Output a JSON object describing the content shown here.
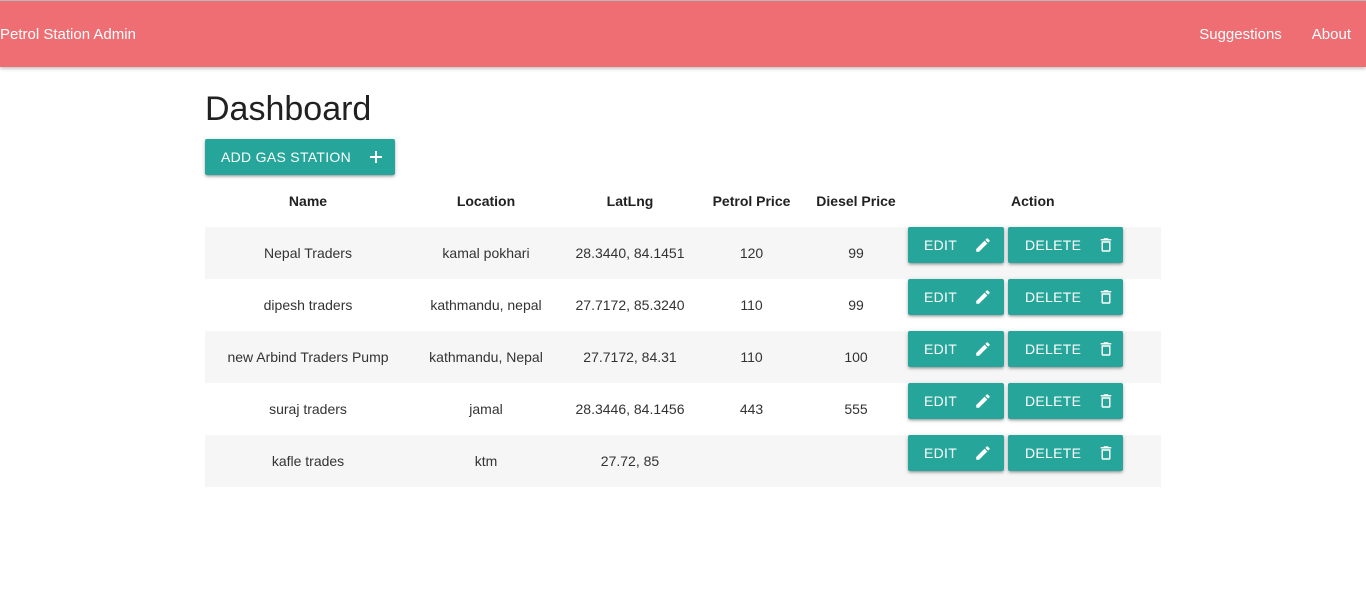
{
  "navbar": {
    "brand": "Petrol Station Admin",
    "links": [
      "Suggestions",
      "About"
    ],
    "color": "#ee6e73"
  },
  "page": {
    "title": "Dashboard",
    "add_button_label": "ADD GAS STATION"
  },
  "table": {
    "headers": [
      "Name",
      "Location",
      "LatLng",
      "Petrol Price",
      "Diesel Price",
      "Action"
    ],
    "edit_label": "EDIT",
    "delete_label": "DELETE",
    "rows": [
      {
        "name": "Nepal Traders",
        "location": "kamal pokhari",
        "latlng": "28.3440, 84.1451",
        "petrol": "120",
        "diesel": "99"
      },
      {
        "name": "dipesh traders",
        "location": "kathmandu, nepal",
        "latlng": "27.7172, 85.3240",
        "petrol": "110",
        "diesel": "99"
      },
      {
        "name": "new Arbind Traders Pump",
        "location": "kathmandu, Nepal",
        "latlng": "27.7172, 84.31",
        "petrol": "110",
        "diesel": "100"
      },
      {
        "name": "suraj traders",
        "location": "jamal",
        "latlng": "28.3446, 84.1456",
        "petrol": "443",
        "diesel": "555"
      },
      {
        "name": "kafle trades",
        "location": "ktm",
        "latlng": "27.72, 85",
        "petrol": "",
        "diesel": ""
      }
    ]
  },
  "colors": {
    "accent": "#26a69a",
    "stripe": "#f6f6f6"
  },
  "icons": {
    "add": "plus-icon",
    "edit": "pencil-icon",
    "delete": "trash-icon"
  }
}
